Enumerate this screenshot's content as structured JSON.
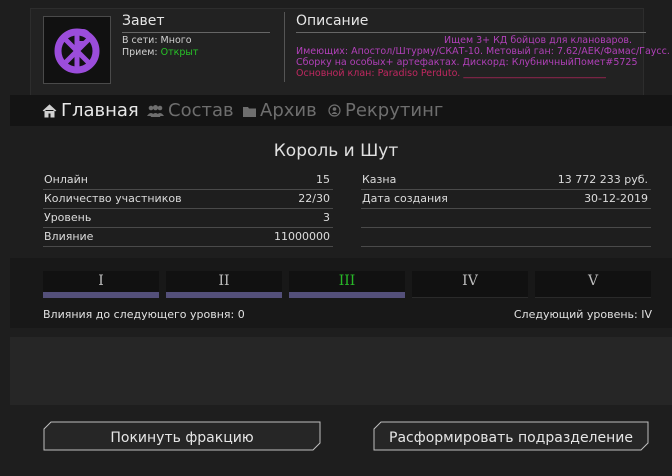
{
  "header": {
    "clan_name": "Завет",
    "online_label": "В сети:",
    "online_value": "Много",
    "recruit_label": "Прием:",
    "recruit_value": "Открыт",
    "description_title": "Описание",
    "description_lines": [
      "Ищем 3+ КД бойцов для клановаров.",
      "Имеющих: Апостол/Штурму/СКАТ-10. Метовый ган: 7.62/АЕК/Фамас/Гаусс.",
      "Сборку на особых+ артефактах. Дискорд: КлубничныйПомет#5725",
      "Основной клан: Paradiso Perduto. ______________________________"
    ],
    "colors": {
      "description": "#b040b8",
      "online": "#27c427",
      "logo": "#9b4ddb"
    }
  },
  "nav": {
    "tabs": [
      {
        "label": "Главная",
        "icon": "home-icon",
        "active": true
      },
      {
        "label": "Состав",
        "icon": "members-icon",
        "active": false
      },
      {
        "label": "Архив",
        "icon": "folder-icon",
        "active": false
      },
      {
        "label": "Рекрутинг",
        "icon": "recruit-icon",
        "active": false
      }
    ]
  },
  "info": {
    "title": "Король и Шут",
    "left": [
      {
        "label": "Онлайн",
        "value": "15"
      },
      {
        "label": "Количество участников",
        "value": "22/30"
      },
      {
        "label": "Уровень",
        "value": "3"
      },
      {
        "label": "Влияние",
        "value": "11000000"
      }
    ],
    "right": [
      {
        "label": "Казна",
        "value": "13 772 233 руб."
      },
      {
        "label": "Дата создания",
        "value": "30-12-2019"
      },
      {
        "label": "",
        "value": ""
      },
      {
        "label": "",
        "value": ""
      }
    ]
  },
  "levels": {
    "items": [
      "I",
      "II",
      "III",
      "IV",
      "V"
    ],
    "current_index": 2,
    "influence_to_next": "Влияния до следующего уровня: 0",
    "next_level": "Следующий уровень: IV"
  },
  "actions": {
    "leave": "Покинуть фракцию",
    "disband": "Расформировать подразделение"
  }
}
